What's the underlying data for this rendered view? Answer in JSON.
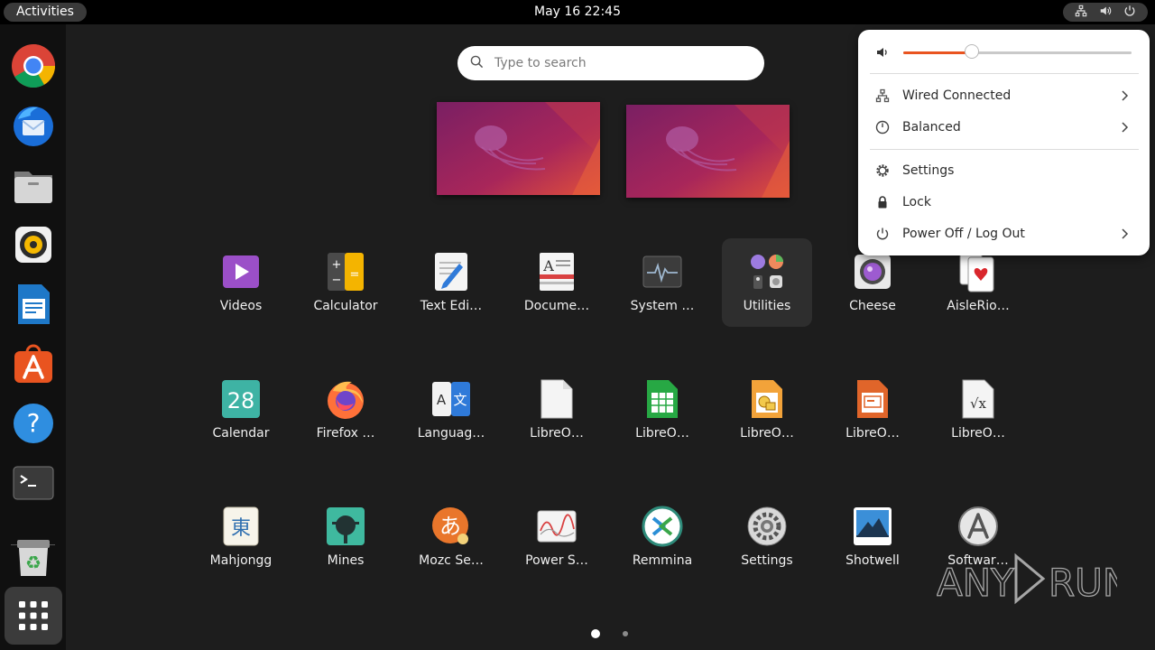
{
  "topbar": {
    "activities_label": "Activities",
    "clock": "May 16  22:45",
    "tray_icons": [
      "network-wired-icon",
      "volume-icon",
      "power-icon"
    ]
  },
  "dock": {
    "items": [
      "google-chrome",
      "thunderbird",
      "files",
      "rhythmbox",
      "libreoffice-writer",
      "app-center",
      "help",
      "terminal",
      "trash"
    ],
    "show_apps_icon": "show-apps-grid-icon"
  },
  "search": {
    "placeholder": "Type to search"
  },
  "apps": [
    {
      "label": "Videos",
      "icon": "videos-icon"
    },
    {
      "label": "Calculator",
      "icon": "calculator-icon"
    },
    {
      "label": "Text Edi…",
      "icon": "text-editor-icon"
    },
    {
      "label": "Docume…",
      "icon": "document-viewer-icon"
    },
    {
      "label": "System …",
      "icon": "system-monitor-icon"
    },
    {
      "label": "Utilities",
      "icon": "utilities-folder-icon",
      "highlighted": true
    },
    {
      "label": "Cheese",
      "icon": "cheese-icon"
    },
    {
      "label": "AisleRio…",
      "icon": "aisleriot-icon"
    },
    {
      "label": "Calendar",
      "icon": "calendar-icon",
      "icon_text": "28"
    },
    {
      "label": "Firefox …",
      "icon": "firefox-icon"
    },
    {
      "label": "Languag…",
      "icon": "language-icon",
      "icon_text_a": "A",
      "icon_text_b": "文"
    },
    {
      "label": "LibreO…",
      "icon": "libreoffice-icon"
    },
    {
      "label": "LibreO…",
      "icon": "libreoffice-calc-icon"
    },
    {
      "label": "LibreO…",
      "icon": "libreoffice-draw-icon"
    },
    {
      "label": "LibreO…",
      "icon": "libreoffice-impress-icon"
    },
    {
      "label": "LibreO…",
      "icon": "libreoffice-math-icon",
      "icon_text": "√x"
    },
    {
      "label": "Mahjongg",
      "icon": "mahjongg-icon",
      "icon_text": "東"
    },
    {
      "label": "Mines",
      "icon": "mines-icon"
    },
    {
      "label": "Mozc Se…",
      "icon": "mozc-icon",
      "icon_text": "あ"
    },
    {
      "label": "Power S…",
      "icon": "power-statistics-icon"
    },
    {
      "label": "Remmina",
      "icon": "remmina-icon"
    },
    {
      "label": "Settings",
      "icon": "settings-icon"
    },
    {
      "label": "Shotwell",
      "icon": "shotwell-icon"
    },
    {
      "label": "Softwar…",
      "icon": "software-icon"
    }
  ],
  "pagination": {
    "current_page": 1,
    "total_pages": 2
  },
  "system_menu": {
    "volume_fraction": 0.3,
    "items": [
      {
        "label": "Wired Connected",
        "icon": "network-wired-icon",
        "has_submenu": true
      },
      {
        "label": "Balanced",
        "icon": "power-profile-icon",
        "has_submenu": true
      },
      {
        "label": "Settings",
        "icon": "gear-icon",
        "has_submenu": false
      },
      {
        "label": "Lock",
        "icon": "lock-icon",
        "has_submenu": false
      },
      {
        "label": "Power Off / Log Out",
        "icon": "power-icon",
        "has_submenu": true
      }
    ]
  },
  "watermark": {
    "text_left": "ANY",
    "text_right": "RUN"
  },
  "colors": {
    "accent": "#E95420",
    "background": "#1D1D1D",
    "topbar": "#000000",
    "dock": "#101010"
  }
}
